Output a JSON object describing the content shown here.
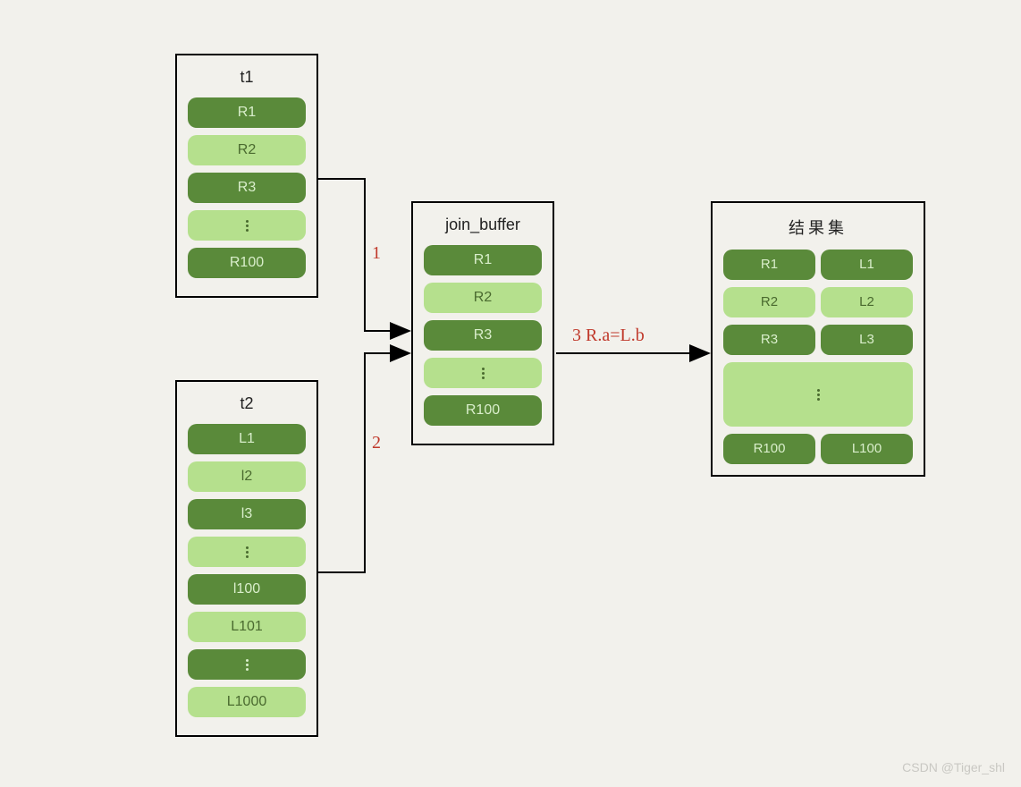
{
  "boxes": {
    "t1": {
      "title": "t1",
      "rows": [
        {
          "text": "R1",
          "cls": "dark"
        },
        {
          "text": "R2",
          "cls": "light"
        },
        {
          "text": "R3",
          "cls": "dark"
        },
        {
          "dots": true,
          "cls": "light"
        },
        {
          "text": "R100",
          "cls": "dark"
        }
      ]
    },
    "t2": {
      "title": "t2",
      "rows": [
        {
          "text": "L1",
          "cls": "dark"
        },
        {
          "text": "l2",
          "cls": "light"
        },
        {
          "text": "l3",
          "cls": "dark"
        },
        {
          "dots": true,
          "cls": "light"
        },
        {
          "text": "l100",
          "cls": "dark"
        },
        {
          "text": "L101",
          "cls": "light"
        },
        {
          "dots": true,
          "cls": "dark"
        },
        {
          "text": "L1000",
          "cls": "light"
        }
      ]
    },
    "join_buffer": {
      "title": "join_buffer",
      "rows": [
        {
          "text": "R1",
          "cls": "dark"
        },
        {
          "text": "R2",
          "cls": "light"
        },
        {
          "text": "R3",
          "cls": "dark"
        },
        {
          "dots": true,
          "cls": "light"
        },
        {
          "text": "R100",
          "cls": "dark"
        }
      ]
    },
    "result": {
      "title": "结果集",
      "pairs": [
        {
          "l": "R1",
          "r": "L1",
          "cls": "dark"
        },
        {
          "l": "R2",
          "r": "L2",
          "cls": "light"
        },
        {
          "l": "R3",
          "r": "L3",
          "cls": "dark"
        }
      ],
      "dotsBlock": true,
      "lastPair": {
        "l": "R100",
        "r": "L100",
        "cls": "dark"
      }
    }
  },
  "edgeLabels": {
    "e1": "1",
    "e2": "2",
    "e3": "3 R.a=L.b"
  },
  "watermark": "CSDN @Tiger_shl"
}
